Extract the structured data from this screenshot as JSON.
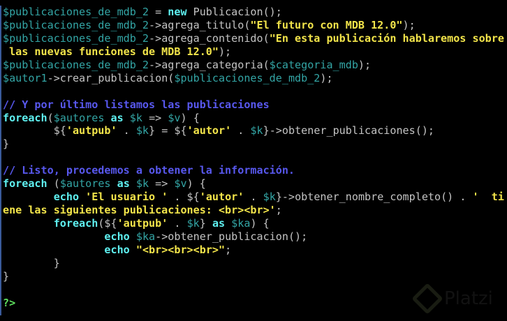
{
  "colors": {
    "variable": "#33a5a5",
    "plain": "#c4c4c4",
    "keyword": "#5ff2f2",
    "string": "#f2e44a",
    "comment": "#5858ee",
    "php_tag": "#5ee05e"
  },
  "watermark": {
    "text": "Platzi",
    "icon": "platzi-logo-icon"
  },
  "lines": [
    [
      [
        "v",
        "$publicaciones_de_mdb_2"
      ],
      [
        "p",
        " = "
      ],
      [
        "k",
        "new"
      ],
      [
        "p",
        " Publicacion();"
      ]
    ],
    [
      [
        "v",
        "$publicaciones_de_mdb_2"
      ],
      [
        "p",
        "->agrega_titulo("
      ],
      [
        "s",
        "\"El futuro con MDB 12.0\""
      ],
      [
        "p",
        ");"
      ]
    ],
    [
      [
        "v",
        "$publicaciones_de_mdb_2"
      ],
      [
        "p",
        "->agrega_contenido("
      ],
      [
        "s",
        "\"En esta publicación hablaremos sobre"
      ]
    ],
    [
      [
        "s",
        " las nuevas funciones de MDB 12.0\""
      ],
      [
        "p",
        ");"
      ]
    ],
    [
      [
        "v",
        "$publicaciones_de_mdb_2"
      ],
      [
        "p",
        "->agrega_categoria("
      ],
      [
        "v",
        "$categoria_mdb"
      ],
      [
        "p",
        ");"
      ]
    ],
    [
      [
        "v",
        "$autor1"
      ],
      [
        "p",
        "->crear_publicacion("
      ],
      [
        "v",
        "$publicaciones_de_mdb_2"
      ],
      [
        "p",
        ");"
      ]
    ],
    [],
    [
      [
        "c",
        "// Y por último listamos las publicaciones"
      ]
    ],
    [
      [
        "k",
        "foreach"
      ],
      [
        "p",
        "("
      ],
      [
        "v",
        "$autores"
      ],
      [
        "p",
        " "
      ],
      [
        "k",
        "as"
      ],
      [
        "p",
        " "
      ],
      [
        "v",
        "$k"
      ],
      [
        "p",
        " => "
      ],
      [
        "v",
        "$v"
      ],
      [
        "p",
        ") {"
      ]
    ],
    [
      [
        "p",
        "        ${"
      ],
      [
        "s",
        "'autpub'"
      ],
      [
        "p",
        " . "
      ],
      [
        "v",
        "$k"
      ],
      [
        "p",
        "} = ${"
      ],
      [
        "s",
        "'autor'"
      ],
      [
        "p",
        " . "
      ],
      [
        "v",
        "$k"
      ],
      [
        "p",
        "}->obtener_publicaciones();"
      ]
    ],
    [
      [
        "p",
        "}"
      ]
    ],
    [],
    [
      [
        "c",
        "// Listo, procedemos a obtener la información."
      ]
    ],
    [
      [
        "k",
        "foreach"
      ],
      [
        "p",
        " ("
      ],
      [
        "v",
        "$autores"
      ],
      [
        "p",
        " "
      ],
      [
        "k",
        "as"
      ],
      [
        "p",
        " "
      ],
      [
        "v",
        "$k"
      ],
      [
        "p",
        " => "
      ],
      [
        "v",
        "$v"
      ],
      [
        "p",
        ") {"
      ]
    ],
    [
      [
        "p",
        "        "
      ],
      [
        "k",
        "echo"
      ],
      [
        "p",
        " "
      ],
      [
        "s",
        "'El usuario '"
      ],
      [
        "p",
        " . ${"
      ],
      [
        "s",
        "'autor'"
      ],
      [
        "p",
        " . "
      ],
      [
        "v",
        "$k"
      ],
      [
        "p",
        "}->obtener_nombre_completo() . "
      ],
      [
        "s",
        "'  ti"
      ]
    ],
    [
      [
        "s",
        "ene las siguientes publicaciones: <br><br>'"
      ],
      [
        "p",
        ";"
      ]
    ],
    [
      [
        "p",
        "        "
      ],
      [
        "k",
        "foreach"
      ],
      [
        "p",
        "(${"
      ],
      [
        "s",
        "'autpub'"
      ],
      [
        "p",
        " . "
      ],
      [
        "v",
        "$k"
      ],
      [
        "p",
        "} "
      ],
      [
        "k",
        "as"
      ],
      [
        "p",
        " "
      ],
      [
        "v",
        "$ka"
      ],
      [
        "p",
        ") {"
      ]
    ],
    [
      [
        "p",
        "                "
      ],
      [
        "k",
        "echo"
      ],
      [
        "p",
        " "
      ],
      [
        "v",
        "$ka"
      ],
      [
        "p",
        "->obtener_publicacion();"
      ]
    ],
    [
      [
        "p",
        "                "
      ],
      [
        "k",
        "echo"
      ],
      [
        "p",
        " "
      ],
      [
        "s",
        "\"<br><br><br>\""
      ],
      [
        "p",
        ";"
      ]
    ],
    [
      [
        "p",
        "        }"
      ]
    ],
    [
      [
        "p",
        "}"
      ]
    ],
    [],
    [
      [
        "t",
        "?>"
      ]
    ]
  ]
}
